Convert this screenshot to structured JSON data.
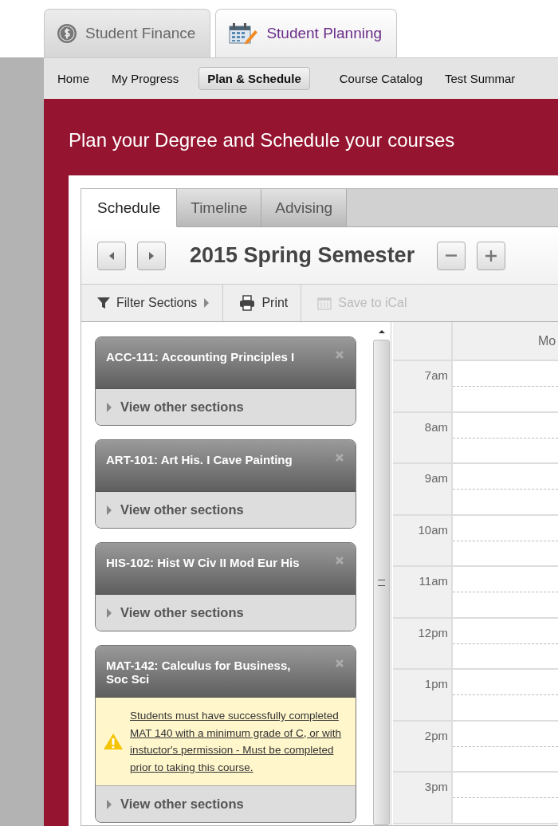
{
  "app_tabs": [
    {
      "label": "Student Finance",
      "selected": false
    },
    {
      "label": "Student Planning",
      "selected": true
    }
  ],
  "nav": [
    {
      "label": "Home",
      "selected": false
    },
    {
      "label": "My Progress",
      "selected": false
    },
    {
      "label": "Plan & Schedule",
      "selected": true
    },
    {
      "label": "Course Catalog",
      "selected": false
    },
    {
      "label": "Test Summar",
      "selected": false
    }
  ],
  "heading": "Plan your Degree and Schedule your courses",
  "schedule_tabs": [
    {
      "label": "Schedule",
      "selected": true
    },
    {
      "label": "Timeline",
      "selected": false
    },
    {
      "label": "Advising",
      "selected": false
    }
  ],
  "term": {
    "title": "2015 Spring Semester"
  },
  "toolbar": [
    {
      "kind": "filter",
      "label": "Filter Sections",
      "disabled": false
    },
    {
      "kind": "print",
      "label": "Print",
      "disabled": false
    },
    {
      "kind": "ical",
      "label": "Save to iCal",
      "disabled": true
    }
  ],
  "courses": [
    {
      "title": "ACC-111: Accounting Principles I",
      "link": "View other sections"
    },
    {
      "title": "ART-101: Art His. I Cave Painting",
      "link": "View other sections"
    },
    {
      "title": "HIS-102: Hist W Civ II Mod Eur His",
      "link": "View other sections"
    },
    {
      "title": "MAT-142: Calculus for Business, Soc Sci",
      "warning": "Students must have successfully completed MAT 140 with a minimum grade of C, or with instuctor's permission - Must be completed prior to taking this course.",
      "link": "View other sections"
    }
  ],
  "calendar": {
    "day_header": "Mo",
    "times": [
      "7am",
      "8am",
      "9am",
      "10am",
      "11am",
      "12pm",
      "1pm",
      "2pm",
      "3pm"
    ]
  }
}
